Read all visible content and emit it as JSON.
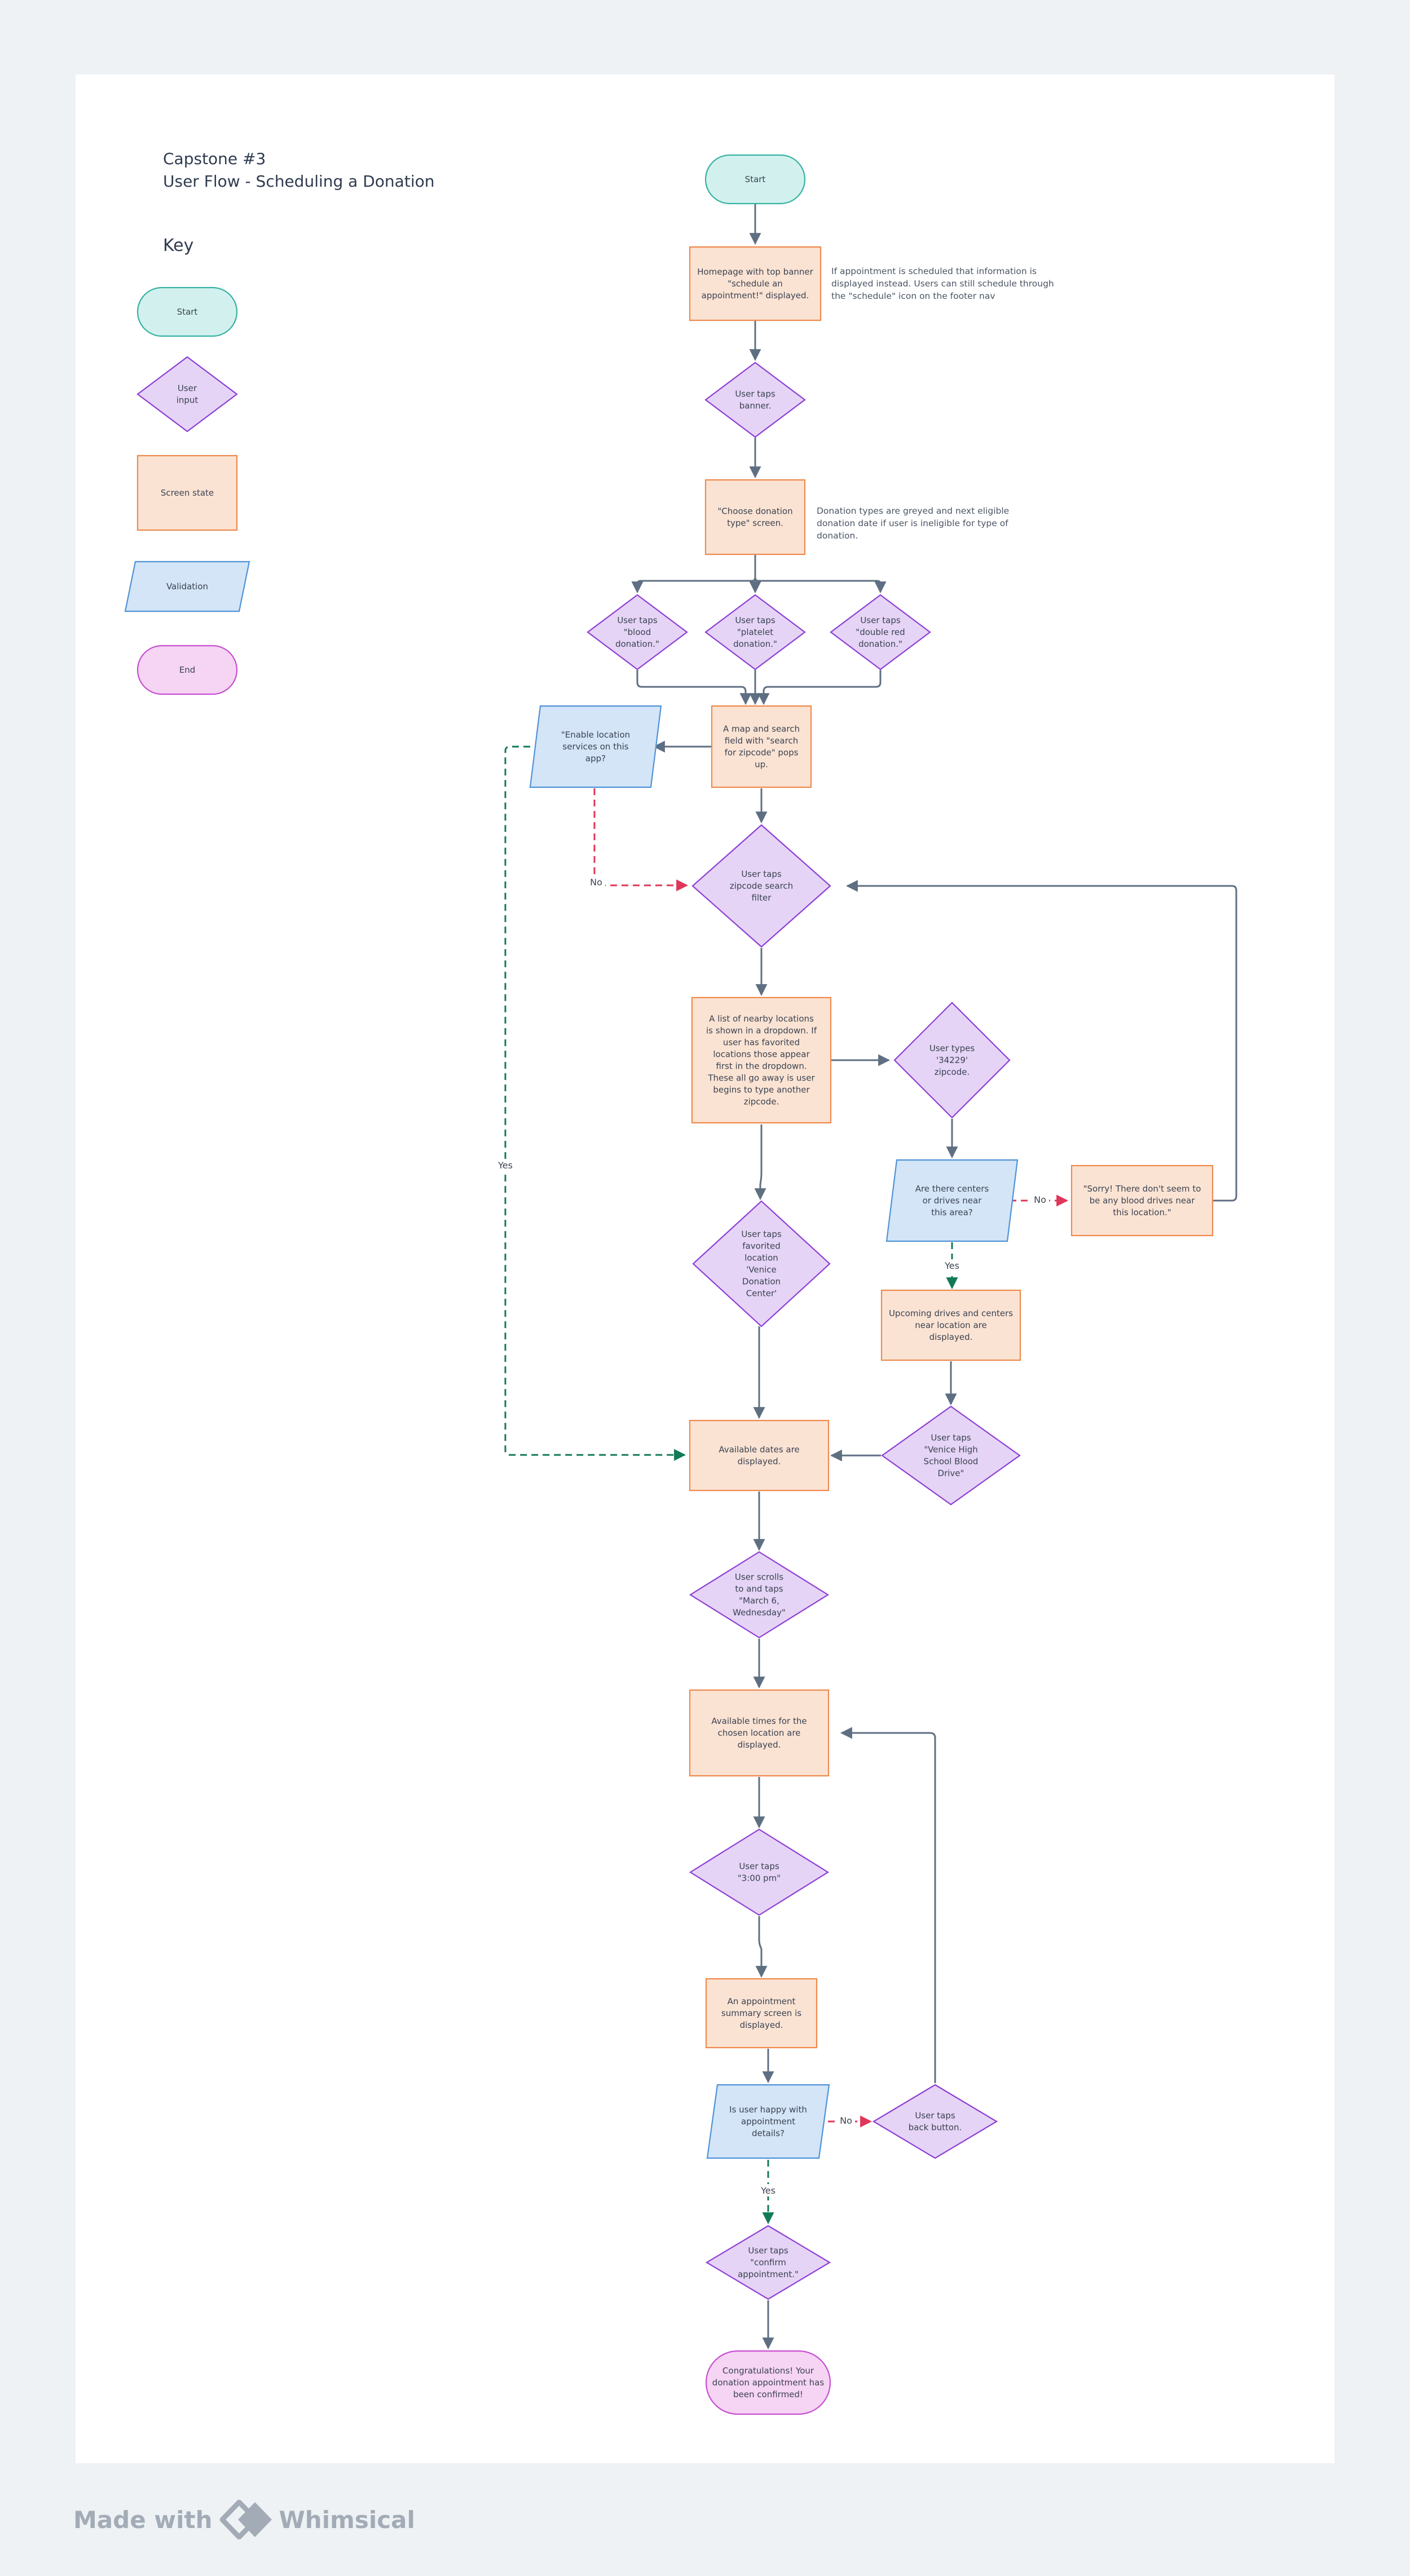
{
  "title": {
    "line1": "Capstone #3",
    "line2": "User Flow - Scheduling a Donation"
  },
  "key": {
    "heading": "Key",
    "items": [
      "Start",
      "User input",
      "Screen state",
      "Validation",
      "End"
    ]
  },
  "nodes": [
    {
      "id": "n1",
      "text": "Start"
    },
    {
      "id": "n2",
      "text": "Homepage with top banner \"schedule an appointment!\" displayed."
    },
    {
      "id": "n3",
      "text": "User taps banner."
    },
    {
      "id": "n4",
      "text": "\"Choose donation type\" screen."
    },
    {
      "id": "n5",
      "text": "User taps \"blood donation.\""
    },
    {
      "id": "n6",
      "text": "User taps \"platelet donation.\""
    },
    {
      "id": "n7",
      "text": "User taps \"double red donation.\""
    },
    {
      "id": "n8",
      "text": "A map and search field with \"search for zipcode\" pops up."
    },
    {
      "id": "n9",
      "text": "\"Enable location services on this app?"
    },
    {
      "id": "n10",
      "text": "User taps zipcode search filter"
    },
    {
      "id": "n11",
      "text": "A list of nearby locations is shown in a dropdown. If user has favorited locations those appear first in the dropdown. These all go away is user begins to type another zipcode."
    },
    {
      "id": "n12",
      "text": "User types '34229' zipcode."
    },
    {
      "id": "n13",
      "text": "Are there centers or drives near this area?"
    },
    {
      "id": "n14",
      "text": "\"Sorry! There don't seem to be any blood drives near this location.\""
    },
    {
      "id": "n15",
      "text": "User taps favorited location 'Venice Donation Center'"
    },
    {
      "id": "n16",
      "text": "Upcoming drives and centers near location are displayed."
    },
    {
      "id": "n17",
      "text": "User taps \"Venice High School Blood Drive\""
    },
    {
      "id": "n18",
      "text": "Available dates are displayed."
    },
    {
      "id": "n19",
      "text": "User scrolls to and taps \"March 6, Wednesday\""
    },
    {
      "id": "n20",
      "text": "Available times for the chosen location are displayed."
    },
    {
      "id": "n21",
      "text": "User taps \"3:00 pm\""
    },
    {
      "id": "n22",
      "text": "An appointment summary screen is displayed."
    },
    {
      "id": "n23",
      "text": "Is user happy with appointment details?"
    },
    {
      "id": "n24",
      "text": "User taps back button."
    },
    {
      "id": "n25",
      "text": "User taps \"confirm appointment.\""
    },
    {
      "id": "n26",
      "text": "Congratulations! Your donation appointment has been confirmed!"
    }
  ],
  "notes": {
    "homepage": "If appointment is scheduled that information is displayed instead. Users can still schedule through the \"schedule\" icon on the footer nav",
    "donation_type": "Donation types are greyed and next eligible donation date if user is ineligible for type of donation."
  },
  "edge_labels": {
    "no": "No",
    "yes": "Yes"
  },
  "footer": {
    "made_with": "Made with",
    "brand": "Whimsical"
  },
  "colors": {
    "start_fill": "#d2f1ee",
    "start_stroke": "#36b2a3",
    "input_fill": "#e5d4f6",
    "input_stroke": "#8e3ed6",
    "screen_fill": "#fbe3d3",
    "screen_stroke": "#ee8a4e",
    "validation_fill": "#d3e5f7",
    "validation_stroke": "#4f93d8",
    "end_fill": "#f6d4f3",
    "end_stroke": "#c84fd3",
    "edge": "#5f6f82",
    "no_edge": "#e0365a",
    "yes_edge": "#127a56"
  }
}
